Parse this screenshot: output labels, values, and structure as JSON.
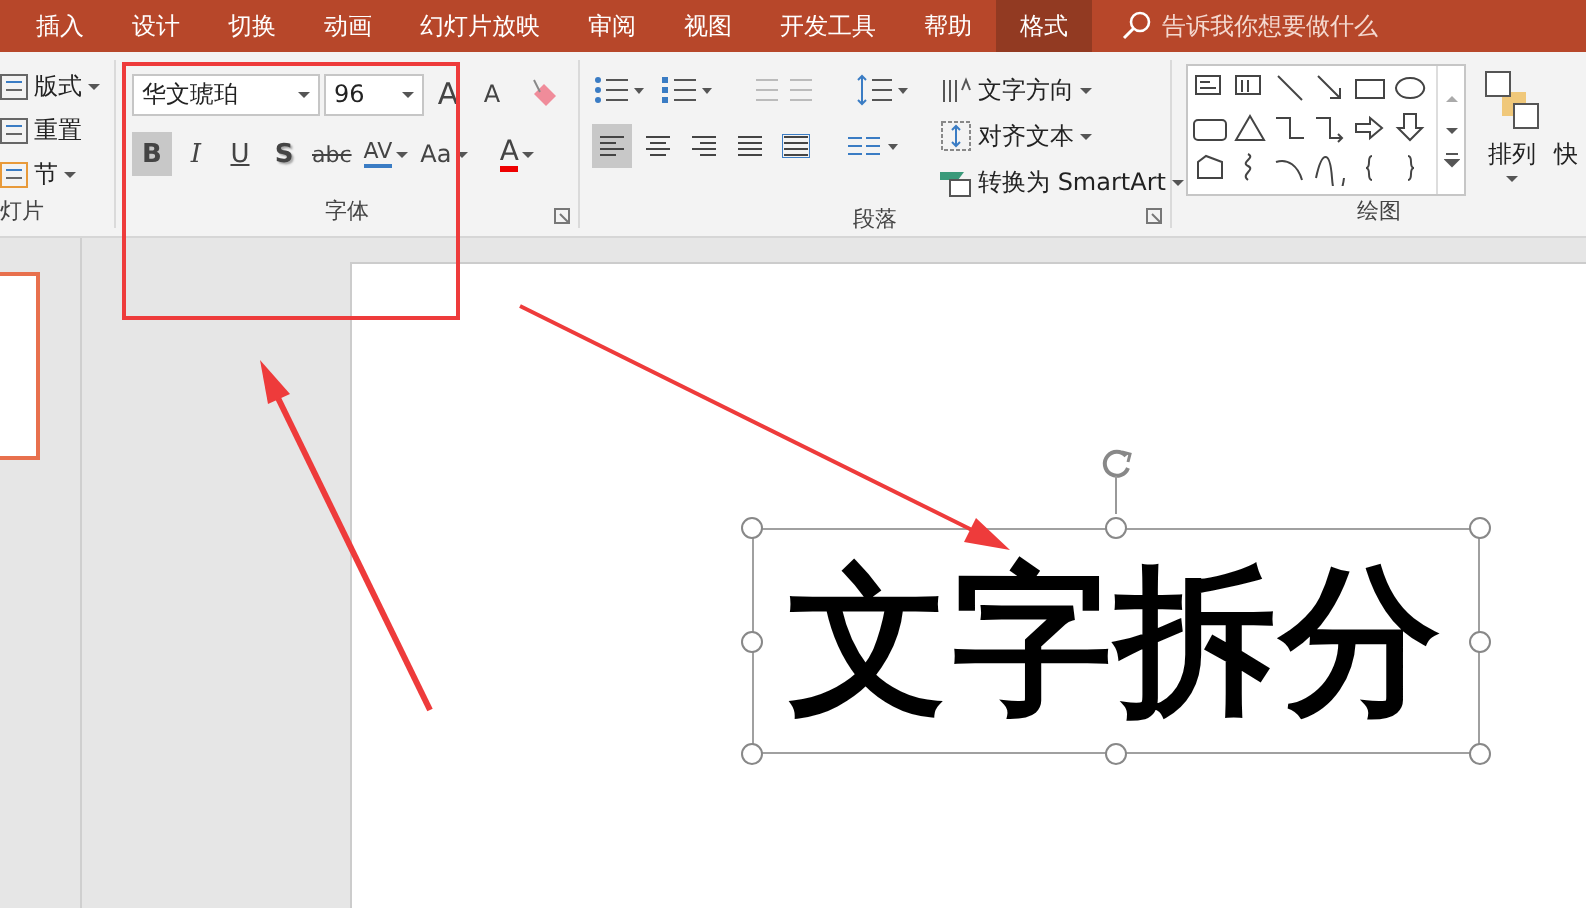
{
  "menu_tabs": [
    {
      "label": "插入",
      "selected": false
    },
    {
      "label": "设计",
      "selected": false
    },
    {
      "label": "切换",
      "selected": false
    },
    {
      "label": "动画",
      "selected": false
    },
    {
      "label": "幻灯片放映",
      "selected": false
    },
    {
      "label": "审阅",
      "selected": false
    },
    {
      "label": "视图",
      "selected": false
    },
    {
      "label": "开发工具",
      "selected": false
    },
    {
      "label": "帮助",
      "selected": false
    },
    {
      "label": "格式",
      "selected": true
    }
  ],
  "tell_me": {
    "placeholder": "告诉我你想要做什么"
  },
  "ribbon": {
    "slides_group": {
      "label": "灯片",
      "buttons": [
        {
          "label": "版式",
          "dropdown": true
        },
        {
          "label": "重置",
          "dropdown": false
        },
        {
          "label": "节",
          "dropdown": true
        }
      ]
    },
    "font_group": {
      "label": "字体",
      "font_name": "华文琥珀",
      "font_size": "96",
      "size_buttons": [
        {
          "label": "A",
          "kind": "grow"
        },
        {
          "label": "A",
          "kind": "shrink"
        }
      ],
      "format_buttons": [
        {
          "label": "B",
          "kind": "bold",
          "selected": true
        },
        {
          "label": "I",
          "kind": "italic",
          "selected": false
        },
        {
          "label": "U",
          "kind": "underline",
          "selected": false
        },
        {
          "label": "S",
          "kind": "shadow",
          "selected": false
        },
        {
          "label": "abc",
          "kind": "strike",
          "selected": false
        },
        {
          "label": "AV",
          "kind": "spacing",
          "selected": false
        },
        {
          "label": "Aa",
          "kind": "case",
          "selected": false
        }
      ],
      "font_color": "A"
    },
    "paragraph_group": {
      "label": "段落",
      "commands": [
        "文字方向",
        "对齐文本",
        "转换为 SmartArt"
      ],
      "alignments": [
        {
          "kind": "left",
          "selected": true
        },
        {
          "kind": "center",
          "selected": false
        },
        {
          "kind": "right",
          "selected": false
        },
        {
          "kind": "justify",
          "selected": false
        },
        {
          "kind": "distributed",
          "selected": false
        }
      ]
    },
    "drawing_group": {
      "label": "绘图",
      "arrange": "排列",
      "quick": "快"
    }
  },
  "slide": {
    "text": "文字拆分"
  }
}
